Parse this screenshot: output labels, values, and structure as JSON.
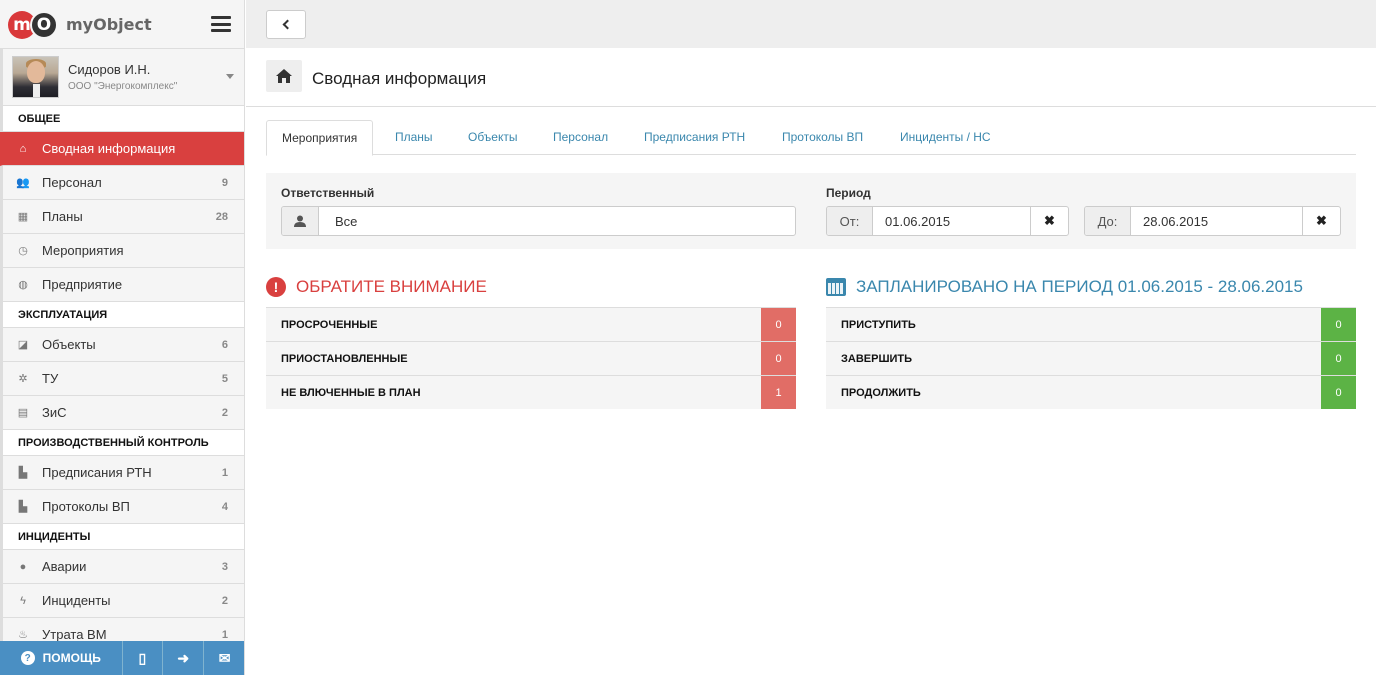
{
  "brand": {
    "name": "myObject",
    "logo_m": "m",
    "logo_o": "O"
  },
  "user": {
    "name": "Сидоров И.Н.",
    "org": "ООО \"Энергокомплекс\""
  },
  "sidebar": {
    "sections": [
      {
        "title": "ОБЩЕЕ",
        "items": [
          {
            "label": "Сводная информация",
            "icon": "home-icon",
            "glyph": "⌂",
            "count": "",
            "active": true
          },
          {
            "label": "Персонал",
            "icon": "users-icon",
            "glyph": "👥",
            "count": "9"
          },
          {
            "label": "Планы",
            "icon": "table-icon",
            "glyph": "▦",
            "count": "28"
          },
          {
            "label": "Мероприятия",
            "icon": "clock-icon",
            "glyph": "◷",
            "count": ""
          },
          {
            "label": "Предприятие",
            "icon": "globe-icon",
            "glyph": "◍",
            "count": ""
          }
        ]
      },
      {
        "title": "ЭКСПЛУАТАЦИЯ",
        "items": [
          {
            "label": "Объекты",
            "icon": "cube-icon",
            "glyph": "◪",
            "count": "6"
          },
          {
            "label": "ТУ",
            "icon": "gear-icon",
            "glyph": "✲",
            "count": "5"
          },
          {
            "label": "ЗиС",
            "icon": "building-icon",
            "glyph": "▤",
            "count": "2"
          }
        ]
      },
      {
        "title": "ПРОИЗВОДСТВЕННЫЙ КОНТРОЛЬ",
        "items": [
          {
            "label": "Предписания РТН",
            "icon": "file-icon",
            "glyph": "▙",
            "count": "1"
          },
          {
            "label": "Протоколы ВП",
            "icon": "file-icon",
            "glyph": "▙",
            "count": "4"
          }
        ]
      },
      {
        "title": "ИНЦИДЕНТЫ",
        "items": [
          {
            "label": "Аварии",
            "icon": "bomb-icon",
            "glyph": "●",
            "count": "3"
          },
          {
            "label": "Инциденты",
            "icon": "bolt-icon",
            "glyph": "ϟ",
            "count": "2"
          },
          {
            "label": "Утрата ВМ",
            "icon": "fire-icon",
            "glyph": "♨",
            "count": "1"
          }
        ]
      }
    ],
    "footer": {
      "help_label": "ПОМОЩЬ",
      "help_glyph": "?",
      "book_glyph": "▯",
      "signin_glyph": "➜",
      "mail_glyph": "✉"
    }
  },
  "header": {
    "title": "Сводная информация"
  },
  "tabs": [
    "Мероприятия",
    "Планы",
    "Объекты",
    "Персонал",
    "Предписания РТН",
    "Протоколы ВП",
    "Инциденты / НС"
  ],
  "filters": {
    "responsible_label": "Ответственный",
    "responsible_value": "Все",
    "period_label": "Период",
    "from_label": "От:",
    "from_value": "01.06.2015",
    "to_label": "До:",
    "to_value": "28.06.2015",
    "clear_glyph": "✖"
  },
  "attention": {
    "title": "ОБРАТИТЕ ВНИМАНИЕ",
    "rows": [
      {
        "label": "ПРОСРОЧЕННЫЕ",
        "value": "0"
      },
      {
        "label": "ПРИОСТАНОВЛЕННЫЕ",
        "value": "0"
      },
      {
        "label": "НЕ ВЛЮЧЕННЫЕ В ПЛАН",
        "value": "1"
      }
    ],
    "color": "#d9403f"
  },
  "planned": {
    "title": "ЗАПЛАНИРОВАНО НА ПЕРИОД 01.06.2015 - 28.06.2015",
    "rows": [
      {
        "label": "ПРИСТУПИТЬ",
        "value": "0"
      },
      {
        "label": "ЗАВЕРШИТЬ",
        "value": "0"
      },
      {
        "label": "ПРОДОЛЖИТЬ",
        "value": "0"
      }
    ],
    "color": "#3a87ad"
  }
}
